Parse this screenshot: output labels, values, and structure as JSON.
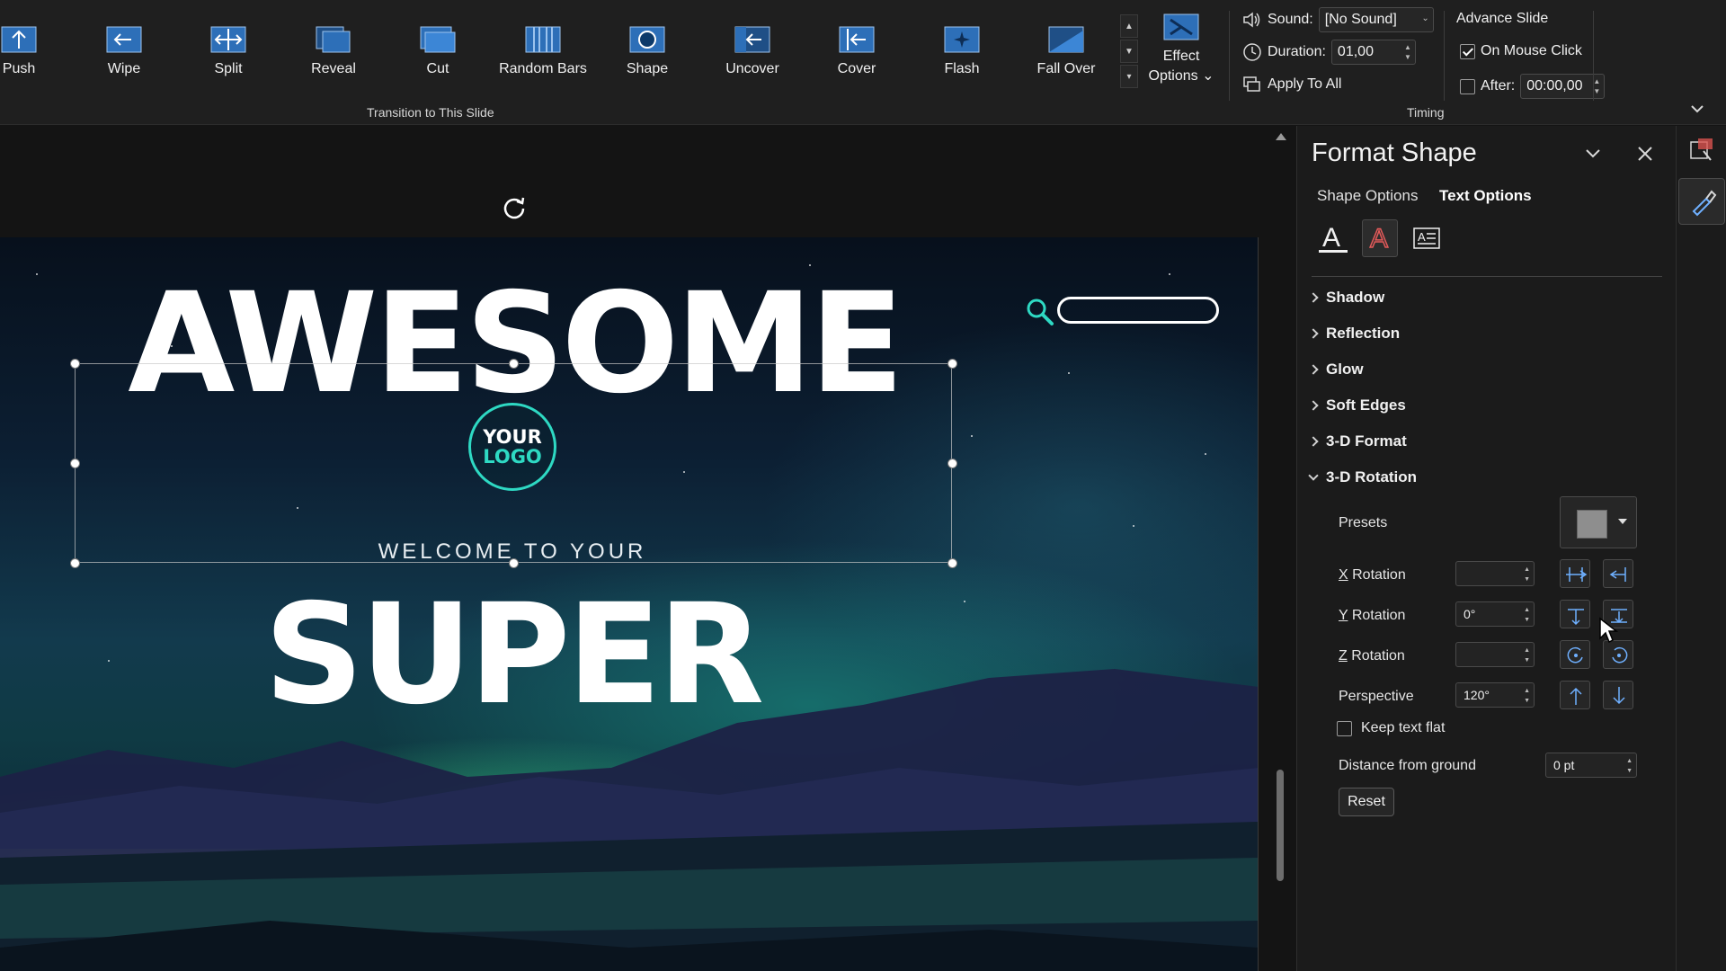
{
  "ribbon": {
    "transitions": [
      {
        "label": "Push",
        "icon": "push-icon"
      },
      {
        "label": "Wipe",
        "icon": "wipe-icon"
      },
      {
        "label": "Split",
        "icon": "split-icon"
      },
      {
        "label": "Reveal",
        "icon": "reveal-icon"
      },
      {
        "label": "Cut",
        "icon": "cut-icon"
      },
      {
        "label": "Random Bars",
        "icon": "random-bars-icon"
      },
      {
        "label": "Shape",
        "icon": "shape-icon"
      },
      {
        "label": "Uncover",
        "icon": "uncover-icon"
      },
      {
        "label": "Cover",
        "icon": "cover-icon"
      },
      {
        "label": "Flash",
        "icon": "flash-icon"
      },
      {
        "label": "Fall Over",
        "icon": "fall-over-icon"
      }
    ],
    "effect_options": {
      "line1": "Effect",
      "line2": "Options ⌄"
    },
    "group_transition_label": "Transition to This Slide",
    "timing": {
      "sound_label": "Sound:",
      "sound_value": "[No Sound]",
      "duration_label": "Duration:",
      "duration_value": "01,00",
      "apply_all_label": "Apply To All",
      "advance_label": "Advance Slide",
      "on_mouse_click_label": "On Mouse Click",
      "on_mouse_click_checked": true,
      "after_label": "After:",
      "after_checked": false,
      "after_value": "00:00,00",
      "group_label": "Timing"
    }
  },
  "slide": {
    "title_top": "AWESOME",
    "logo_line1": "YOUR",
    "logo_line2": "LOGO",
    "subtitle": "WELCOME TO YOUR",
    "title_bottom": "SUPER",
    "accent_color": "#2ed9c3"
  },
  "pane": {
    "title": "Format Shape",
    "tabs": [
      {
        "label": "Shape Options",
        "active": false
      },
      {
        "label": "Text Options",
        "active": true
      }
    ],
    "sections": [
      {
        "label": "Shadow",
        "expanded": false
      },
      {
        "label": "Reflection",
        "expanded": false
      },
      {
        "label": "Glow",
        "expanded": false
      },
      {
        "label": "Soft Edges",
        "expanded": false
      },
      {
        "label": "3-D Format",
        "expanded": false
      },
      {
        "label": "3-D Rotation",
        "expanded": true
      }
    ],
    "rotation": {
      "presets_label": "Presets",
      "x_label_key": "X",
      "x_label_rest": " Rotation",
      "x_value": "",
      "y_label_key": "Y",
      "y_label_rest": " Rotation",
      "y_value": "0°",
      "z_label_key": "Z",
      "z_label_rest": " Rotation",
      "z_value": "",
      "perspective_label": "Perspective",
      "perspective_value": "120°",
      "keep_flat_label": "Keep text flat",
      "keep_flat_checked": false,
      "distance_label": "Distance from ground",
      "distance_value": "0 pt",
      "reset_label": "Reset"
    }
  }
}
